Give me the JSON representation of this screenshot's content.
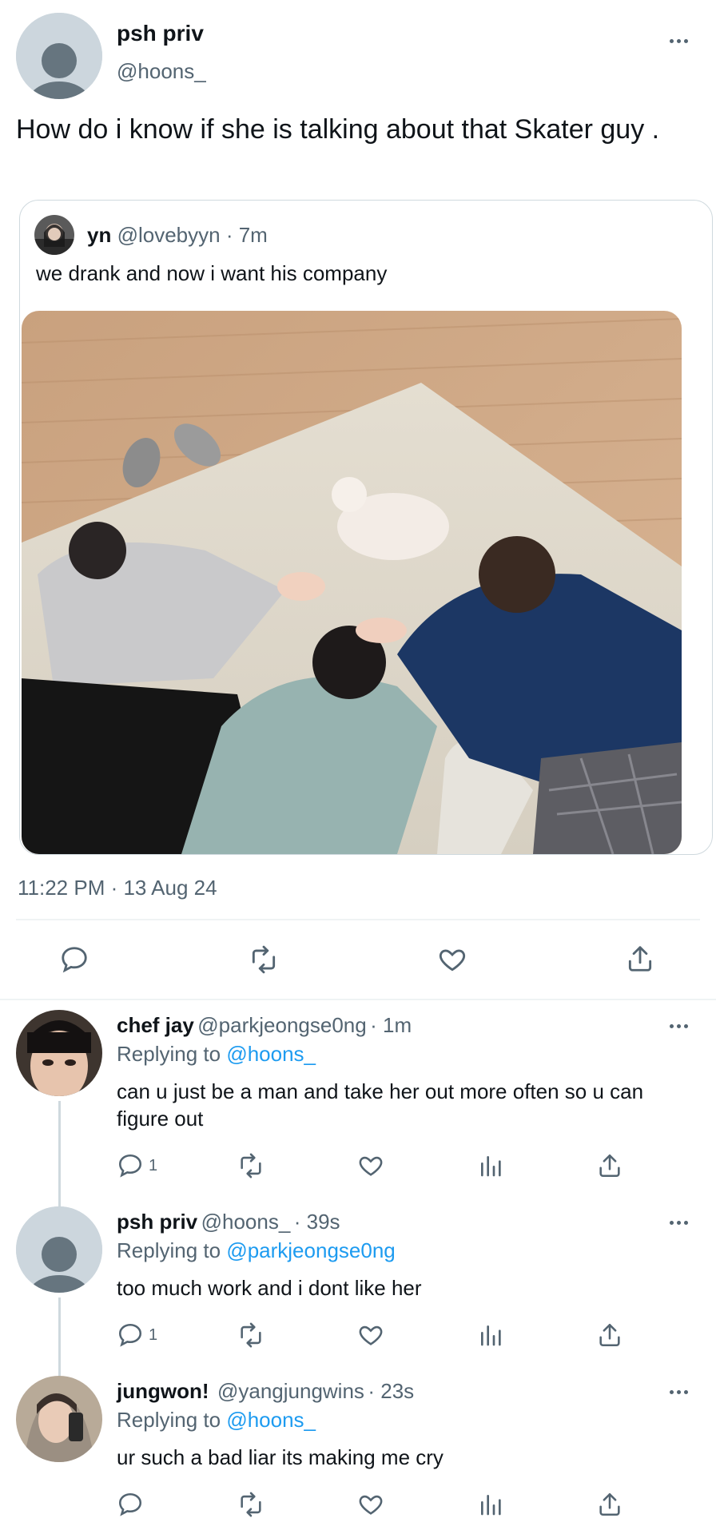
{
  "main_tweet": {
    "display_name": "psh priv",
    "handle": "@hoons_",
    "text": "How do i know if she is talking about that Skater guy .",
    "timestamp": "11:22 PM · 13 Aug 24"
  },
  "quoted_tweet": {
    "display_name": "yn",
    "handle": "@lovebyyn",
    "time": "· 7m",
    "text": "we drank and now i want his company"
  },
  "replies": [
    {
      "display_name": "chef jay",
      "handle": "@parkjeongse0ng",
      "time": "· 1m",
      "replying_prefix": "Replying to",
      "replying_to": "@hoons_",
      "text": "can u just be a man and take her out more often so u can figure out",
      "reply_count": "1"
    },
    {
      "display_name": "psh priv",
      "handle": "@hoons_",
      "time": "· 39s",
      "replying_prefix": "Replying to",
      "replying_to": "@parkjeongse0ng",
      "text": "too much work and i dont like her",
      "reply_count": "1"
    },
    {
      "display_name": "jungwon!",
      "handle": "@yangjungwins",
      "time": "· 23s",
      "replying_prefix": "Replying to",
      "replying_to": "@hoons_",
      "text": "ur such a bad liar its making me cry",
      "reply_count": ""
    }
  ],
  "colors": {
    "accent": "#1d9bf0",
    "muted": "#536471",
    "divider": "#eff3f4"
  },
  "icons": [
    "reply-icon",
    "retweet-icon",
    "like-icon",
    "share-icon",
    "views-icon",
    "more-icon"
  ]
}
